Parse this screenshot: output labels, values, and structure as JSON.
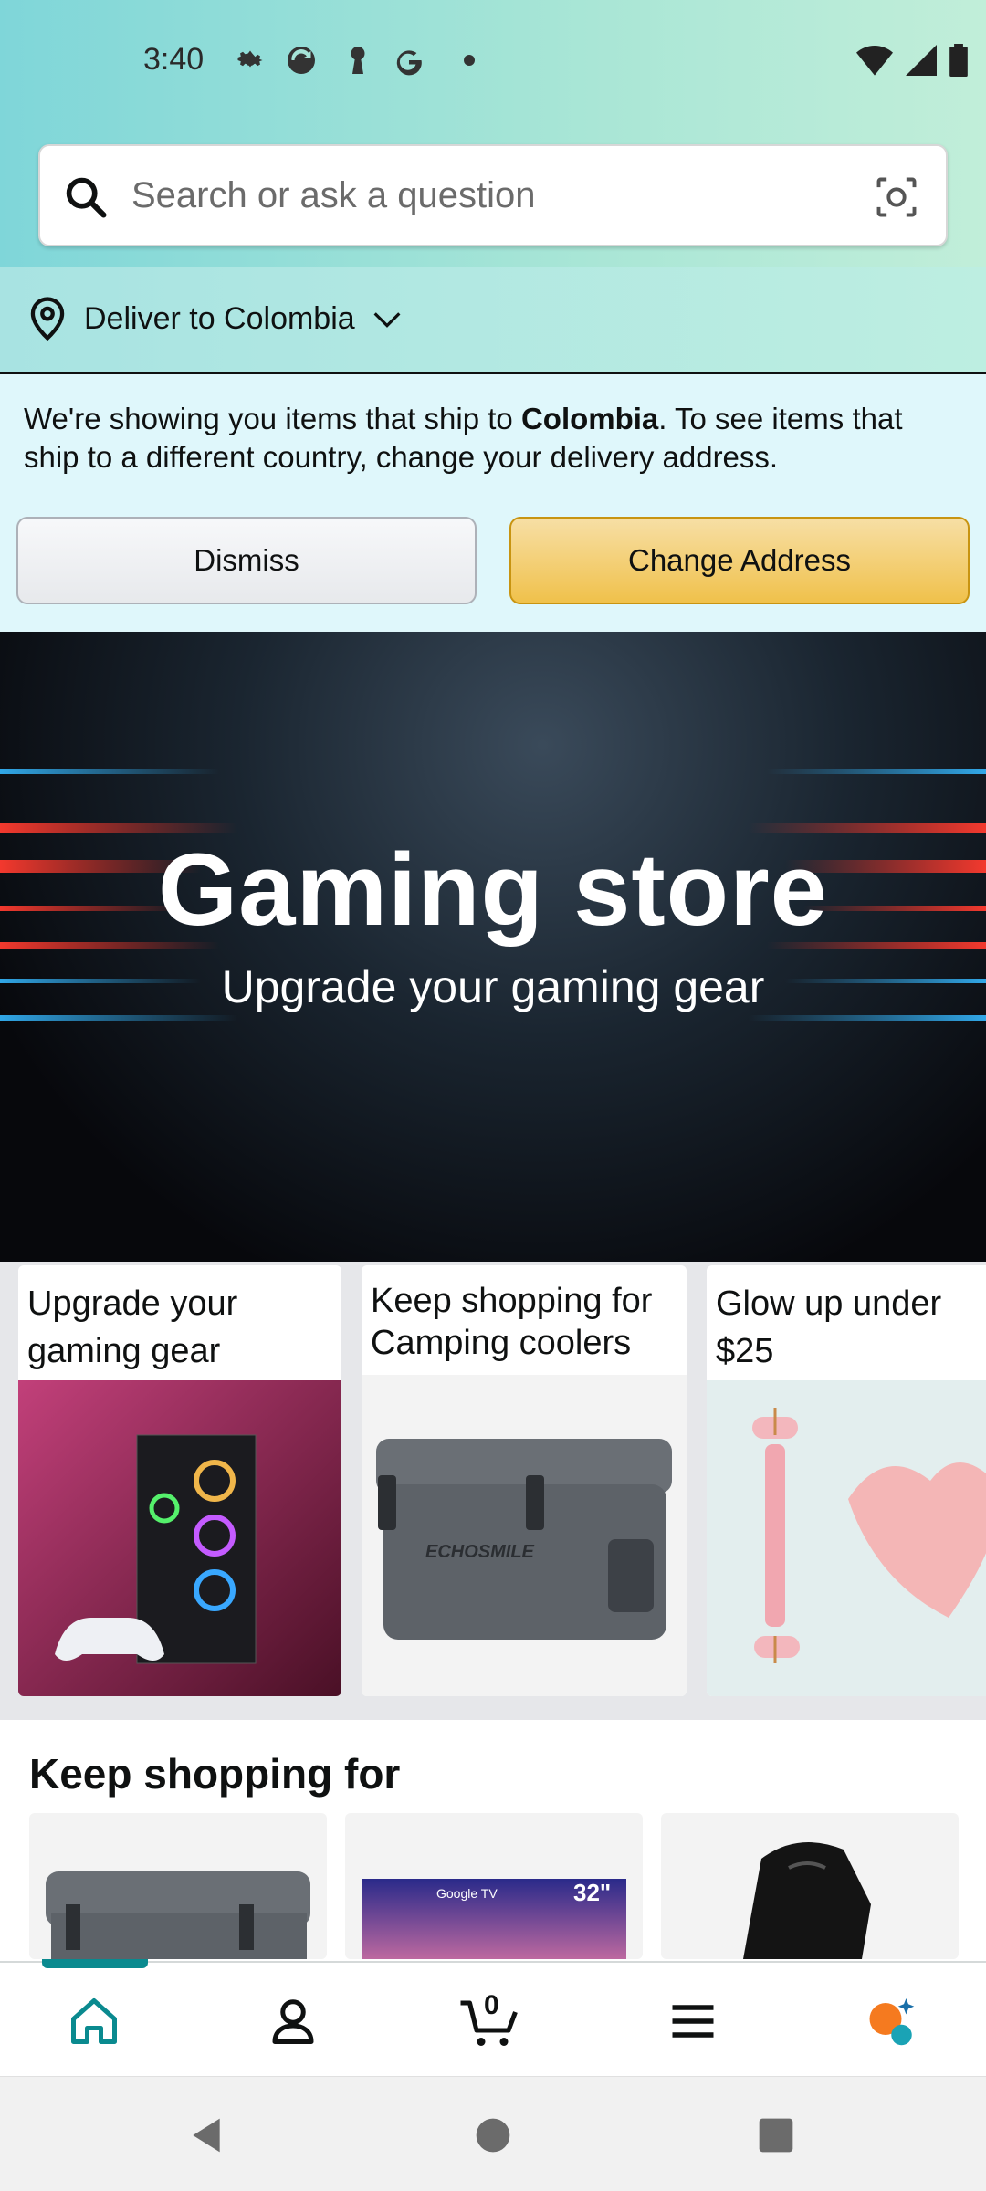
{
  "status_bar": {
    "time": "3:40",
    "icons_left": [
      "gear-icon",
      "sync-icon",
      "keyhole-icon",
      "google-icon",
      "dot-icon"
    ],
    "icons_right": [
      "wifi-icon",
      "signal-icon",
      "battery-icon"
    ]
  },
  "search": {
    "placeholder": "Search or ask a question"
  },
  "delivery": {
    "label": "Deliver to Colombia"
  },
  "notice": {
    "message_prefix": "We're showing you items that ship to ",
    "country": "Colombia",
    "message_suffix": ". To see items that ship to a different country, change your delivery address.",
    "dismiss_label": "Dismiss",
    "change_label": "Change Address"
  },
  "hero": {
    "title": "Gaming store",
    "subtitle": "Upgrade your gaming gear"
  },
  "cards": [
    {
      "title": "Upgrade your gaming gear"
    },
    {
      "title": "Keep shopping for Camping coolers"
    },
    {
      "title": "Glow up under $25"
    }
  ],
  "keep_shopping": {
    "heading": "Keep shopping for",
    "tiles": [
      {
        "brand": ""
      },
      {
        "brand": "Google TV",
        "size": "32\""
      },
      {
        "brand": ""
      }
    ]
  },
  "navbar": {
    "cart_count": "0",
    "items": [
      "home-icon",
      "account-icon",
      "cart-icon",
      "menu-icon",
      "rufus-icon"
    ],
    "accent_color": "#0a8a8f"
  },
  "colors": {
    "change_button": "#f0c14b",
    "notice_bg": "#dff7fb"
  }
}
